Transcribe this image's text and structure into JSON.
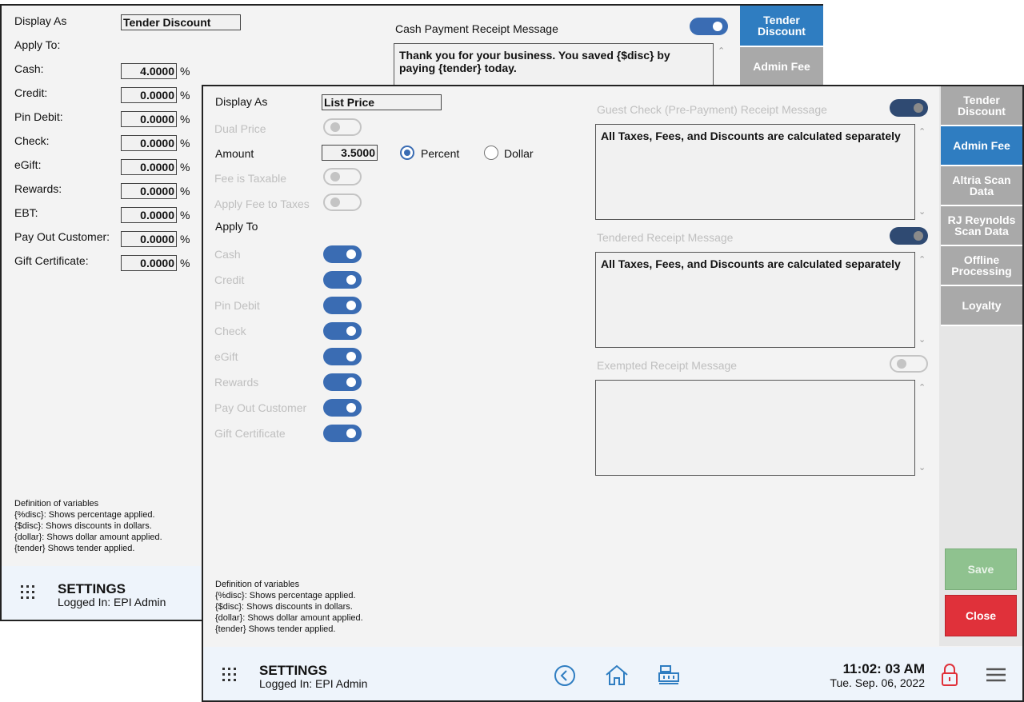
{
  "back_window": {
    "display_as_label": "Display As",
    "display_as_value": "Tender Discount",
    "apply_to_label": "Apply To:",
    "rows": [
      {
        "label": "Cash:",
        "value": "4.0000",
        "unit": "%"
      },
      {
        "label": "Credit:",
        "value": "0.0000",
        "unit": "%"
      },
      {
        "label": "Pin Debit:",
        "value": "0.0000",
        "unit": "%"
      },
      {
        "label": "Check:",
        "value": "0.0000",
        "unit": "%"
      },
      {
        "label": "eGift:",
        "value": "0.0000",
        "unit": "%"
      },
      {
        "label": "Rewards:",
        "value": "0.0000",
        "unit": "%"
      },
      {
        "label": "EBT:",
        "value": "0.0000",
        "unit": "%"
      },
      {
        "label": "Pay Out Customer:",
        "value": "0.0000",
        "unit": "%"
      },
      {
        "label": "Gift Certificate:",
        "value": "0.0000",
        "unit": "%"
      }
    ],
    "receipt_label": "Cash Payment Receipt Message",
    "receipt_text": "Thank you for your business. You saved {$disc} by paying {tender} today.",
    "nav": [
      "Tender Discount",
      "Admin Fee"
    ],
    "definitions": [
      "Definition of variables",
      "{%disc}: Shows percentage applied.",
      "{$disc}:  Shows discounts in dollars.",
      "{dollar}: Shows dollar amount applied.",
      "{tender} Shows tender applied."
    ],
    "footer_title": "SETTINGS",
    "footer_user": "Logged In:  EPI Admin"
  },
  "front_window": {
    "display_as_label": "Display As",
    "display_as_value": "List Price",
    "dual_price_label": "Dual Price",
    "amount_label": "Amount",
    "amount_value": "3.5000",
    "percent_label": "Percent",
    "dollar_label": "Dollar",
    "fee_taxable_label": "Fee is Taxable",
    "apply_fee_taxes_label": "Apply Fee to Taxes",
    "apply_to_label": "Apply To",
    "apply_items": [
      "Cash",
      "Credit",
      "Pin Debit",
      "Check",
      "eGift",
      "Rewards",
      "Pay Out Customer",
      "Gift Certificate"
    ],
    "guest_check_label": "Guest Check (Pre-Payment) Receipt Message",
    "guest_check_text": "All Taxes, Fees, and Discounts are calculated separately",
    "tendered_label": "Tendered Receipt Message",
    "tendered_text": "All Taxes, Fees, and Discounts are calculated separately",
    "exempted_label": "Exempted Receipt Message",
    "exempted_text": "",
    "nav": [
      "Tender Discount",
      "Admin Fee",
      "Altria Scan Data",
      "RJ Reynolds Scan Data",
      "Offline Processing",
      "Loyalty"
    ],
    "save_label": "Save",
    "close_label": "Close",
    "definitions": [
      "Definition of variables",
      "{%disc}: Shows percentage applied.",
      "{$disc}: Shows discounts in dollars.",
      "{dollar}: Shows dollar amount applied.",
      "{tender} Shows tender applied."
    ],
    "footer_title": "SETTINGS",
    "footer_user": "Logged In:  EPI Admin",
    "time": "11:02: 03 AM",
    "date": "Tue. Sep. 06, 2022",
    "icons": [
      "back-circle-icon",
      "home-icon",
      "register-icon",
      "lock-icon",
      "hamburger-menu-icon"
    ]
  },
  "colors": {
    "accent": "#2f7dc1",
    "toggle_on": "#3a6cb3",
    "save": "#8fc28f",
    "close": "#e0313a",
    "nav_inactive": "#a9a9a9"
  }
}
